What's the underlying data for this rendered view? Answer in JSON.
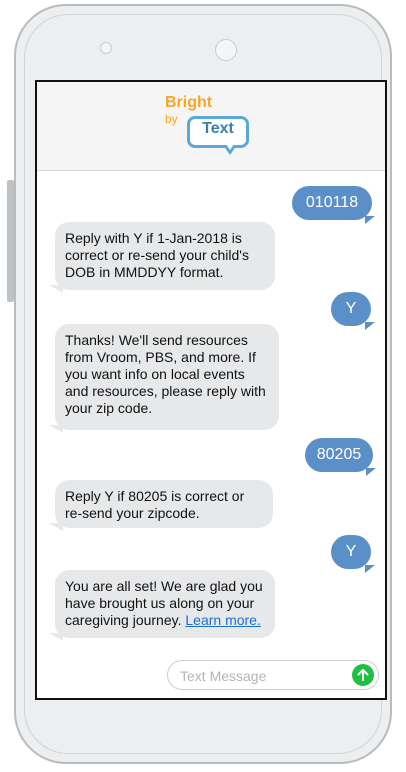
{
  "header": {
    "logo_bright": "Bright",
    "logo_by": "by",
    "logo_text": "Text"
  },
  "messages": [
    {
      "side": "out",
      "text": "010118"
    },
    {
      "side": "in",
      "text": "Reply with Y if 1-Jan-2018 is correct or re-send your child's DOB in MMDDYY format."
    },
    {
      "side": "out",
      "text": "Y"
    },
    {
      "side": "in",
      "text": "Thanks! We'll send resources from Vroom, PBS, and more. If you want info on local events and resources, please reply with your zip code."
    },
    {
      "side": "out",
      "text": "80205"
    },
    {
      "side": "in",
      "text": "Reply Y if 80205 is correct or re-send your zipcode."
    },
    {
      "side": "out",
      "text": "Y"
    },
    {
      "side": "in",
      "text": "You are all set!  We are glad you have brought us along on your caregiving journey.",
      "link": "Learn more."
    }
  ],
  "input": {
    "placeholder": "Text Message",
    "send_icon": "arrow-up-icon"
  },
  "colors": {
    "outgoing": "#5b8fc7",
    "incoming": "#e6e8ea",
    "send": "#1fbf3f",
    "logo_orange": "#f5a623",
    "logo_blue": "#3a7fb2"
  }
}
